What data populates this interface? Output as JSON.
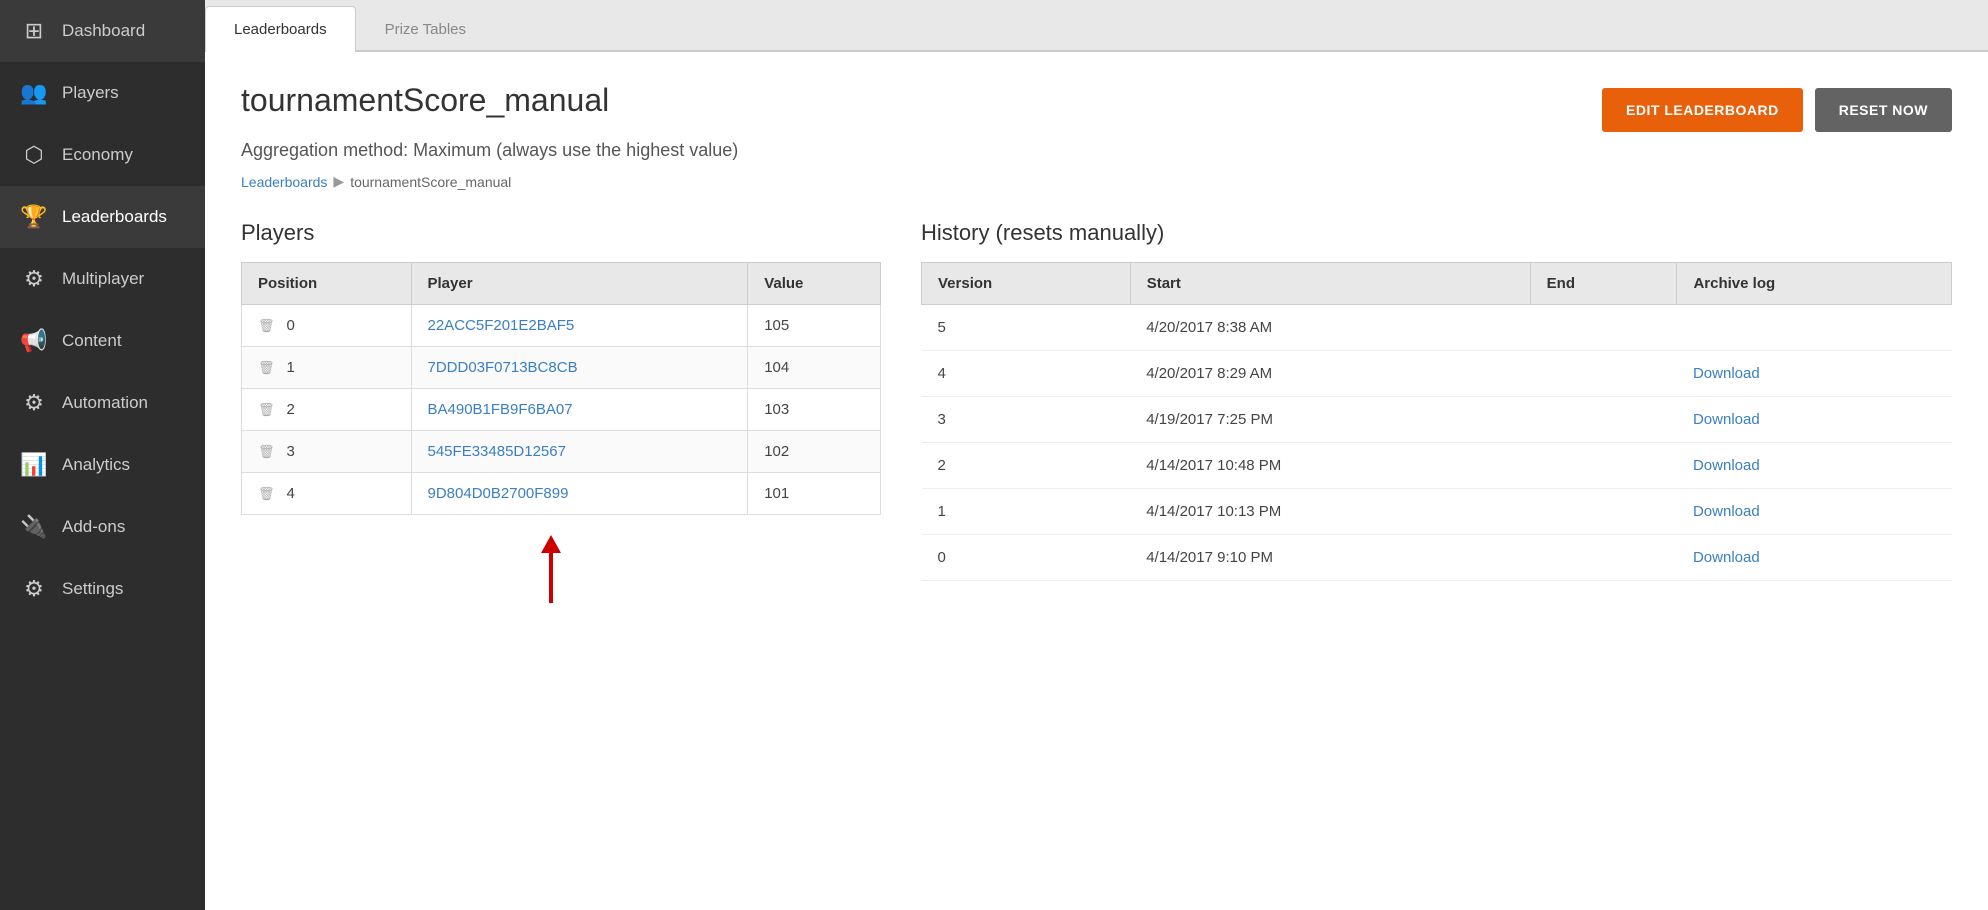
{
  "sidebar": {
    "items": [
      {
        "id": "dashboard",
        "label": "Dashboard",
        "icon": "⊞"
      },
      {
        "id": "players",
        "label": "Players",
        "icon": "👥"
      },
      {
        "id": "economy",
        "label": "Economy",
        "icon": "⬡"
      },
      {
        "id": "leaderboards",
        "label": "Leaderboards",
        "icon": "🏆",
        "active": true
      },
      {
        "id": "multiplayer",
        "label": "Multiplayer",
        "icon": "⚙"
      },
      {
        "id": "content",
        "label": "Content",
        "icon": "📢"
      },
      {
        "id": "automation",
        "label": "Automation",
        "icon": "⚙"
      },
      {
        "id": "analytics",
        "label": "Analytics",
        "icon": "📊"
      },
      {
        "id": "addons",
        "label": "Add-ons",
        "icon": "🔌"
      },
      {
        "id": "settings",
        "label": "Settings",
        "icon": "⚙"
      }
    ]
  },
  "tabs": [
    {
      "id": "leaderboards",
      "label": "Leaderboards",
      "active": true
    },
    {
      "id": "prize-tables",
      "label": "Prize Tables",
      "active": false
    }
  ],
  "leaderboard": {
    "title": "tournamentScore_manual",
    "aggregation": "Aggregation method: Maximum (always use the highest value)",
    "edit_label": "EDIT LEADERBOARD",
    "reset_label": "RESET NOW"
  },
  "breadcrumb": {
    "link_label": "Leaderboards",
    "separator": "▶",
    "current": "tournamentScore_manual"
  },
  "players": {
    "section_title": "Players",
    "columns": [
      "Position",
      "Player",
      "Value"
    ],
    "rows": [
      {
        "position": "0",
        "player": "22ACC5F201E2BAF5",
        "value": "105"
      },
      {
        "position": "1",
        "player": "7DDD03F0713BC8CB",
        "value": "104"
      },
      {
        "position": "2",
        "player": "BA490B1FB9F6BA07",
        "value": "103"
      },
      {
        "position": "3",
        "player": "545FE33485D12567",
        "value": "102"
      },
      {
        "position": "4",
        "player": "9D804D0B2700F899",
        "value": "101"
      }
    ]
  },
  "history": {
    "section_title": "History (resets manually)",
    "columns": [
      "Version",
      "Start",
      "End",
      "Archive log"
    ],
    "rows": [
      {
        "version": "5",
        "start": "4/20/2017 8:38 AM",
        "end": "",
        "download": ""
      },
      {
        "version": "4",
        "start": "4/20/2017 8:29 AM",
        "end": "",
        "download": "Download"
      },
      {
        "version": "3",
        "start": "4/19/2017 7:25 PM",
        "end": "",
        "download": "Download"
      },
      {
        "version": "2",
        "start": "4/14/2017 10:48 PM",
        "end": "",
        "download": "Download"
      },
      {
        "version": "1",
        "start": "4/14/2017 10:13 PM",
        "end": "",
        "download": "Download"
      },
      {
        "version": "0",
        "start": "4/14/2017 9:10 PM",
        "end": "",
        "download": "Download"
      }
    ]
  }
}
